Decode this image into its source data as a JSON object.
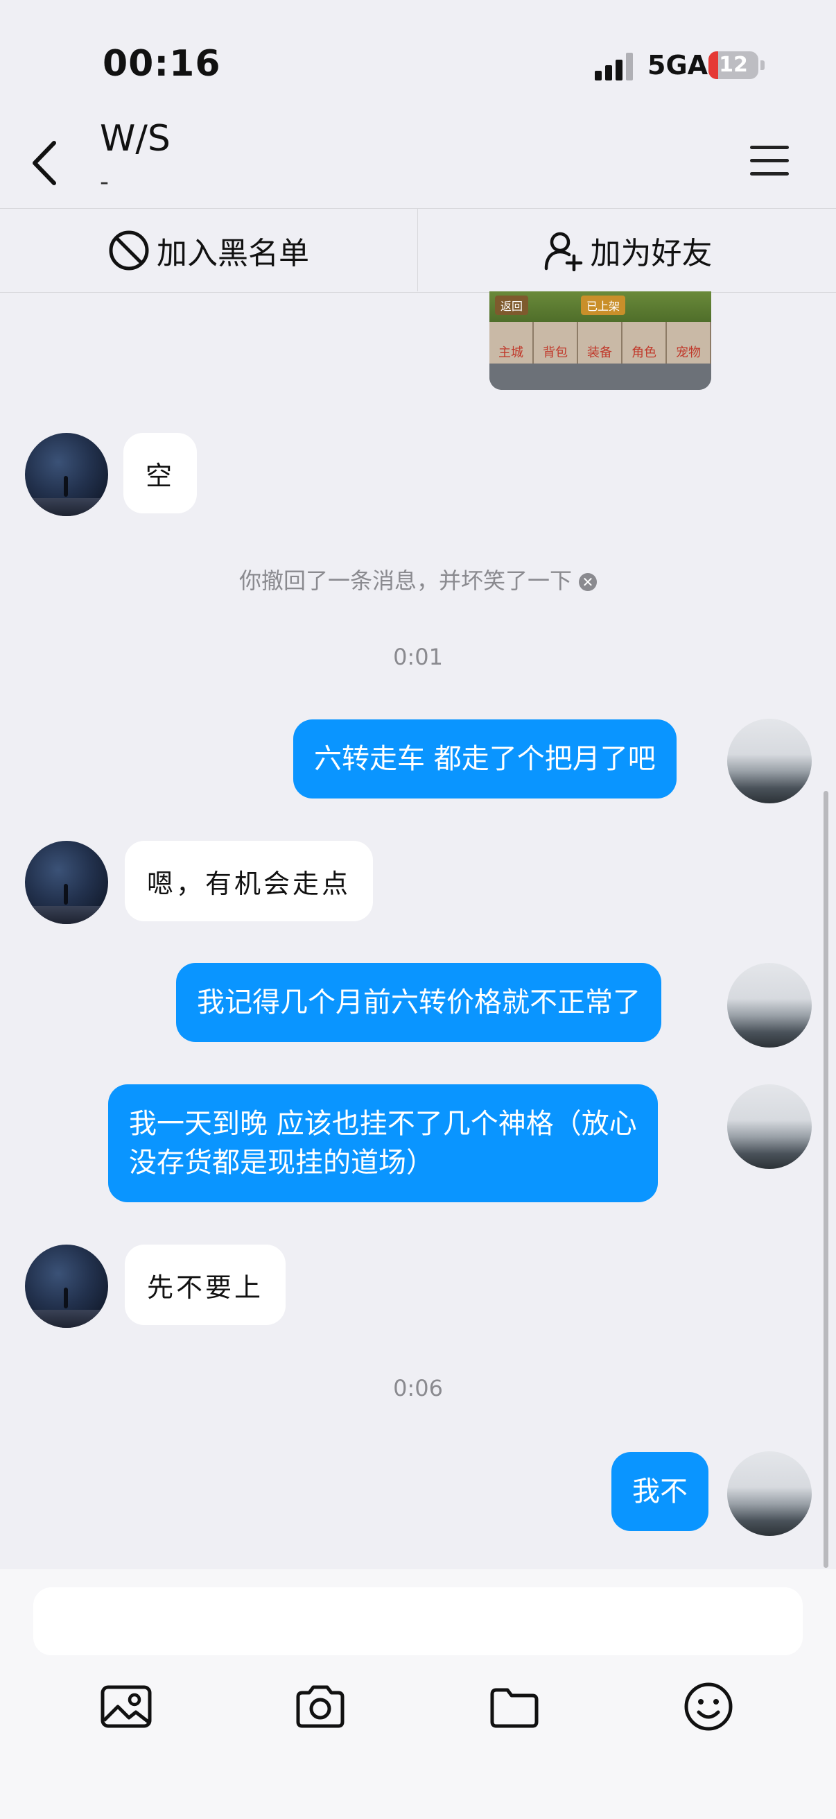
{
  "status_bar": {
    "time": "00:16",
    "network": "5GA",
    "battery": "12"
  },
  "header": {
    "title": "W/S",
    "subtitle": "-",
    "back_icon": "chevron-left-icon",
    "menu_icon": "hamburger-menu-icon"
  },
  "actions": {
    "block_label": "加入黑名单",
    "add_friend_label": "加为好友"
  },
  "image_message": {
    "tag_back": "返回",
    "tag_shelf": "已上架",
    "tabs": [
      "主城",
      "背包",
      "装备",
      "角色",
      "宠物"
    ]
  },
  "messages": {
    "m1": "空",
    "recall_note": "你撤回了一条消息，并坏笑了一下",
    "time1": "0:01",
    "m2": "六转走车 都走了个把月了吧",
    "m3": "嗯，有机会走点",
    "m4": "我记得几个月前六转价格就不正常了",
    "m5_line1": "我一天到晚 应该也挂不了几个神格（放心",
    "m5_line2": "没存货都是现挂的道场）",
    "m6": "先不要上",
    "time2": "0:06",
    "m7": "我不"
  },
  "input": {
    "placeholder": ""
  },
  "toolbar": {
    "icons": [
      "image-icon",
      "camera-icon",
      "folder-icon",
      "emoji-icon"
    ]
  },
  "colors": {
    "bubble_out": "#0a95ff",
    "bubble_in": "#ffffff",
    "background": "#efeff4"
  }
}
